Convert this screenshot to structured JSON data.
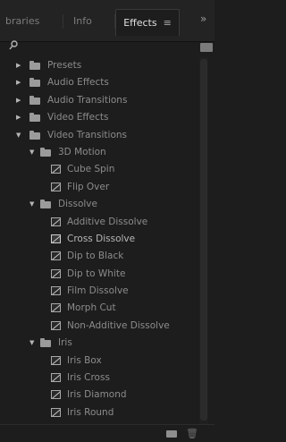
{
  "tabs": [
    {
      "label": "braries"
    },
    {
      "label": "Info"
    },
    {
      "label": "Effects",
      "menu_glyph": "≡"
    }
  ],
  "overflow_glyph": "»",
  "tree": [
    {
      "label": "Presets",
      "kind": "folder",
      "expanded": false,
      "depth": 0
    },
    {
      "label": "Audio Effects",
      "kind": "folder",
      "expanded": false,
      "depth": 0
    },
    {
      "label": "Audio Transitions",
      "kind": "folder",
      "expanded": false,
      "depth": 0
    },
    {
      "label": "Video Effects",
      "kind": "folder",
      "expanded": false,
      "depth": 0
    },
    {
      "label": "Video Transitions",
      "kind": "folder",
      "expanded": true,
      "depth": 0
    },
    {
      "label": "3D Motion",
      "kind": "folder",
      "expanded": true,
      "depth": 1
    },
    {
      "label": "Cube Spin",
      "kind": "effect",
      "depth": 2
    },
    {
      "label": "Flip Over",
      "kind": "effect",
      "depth": 2
    },
    {
      "label": "Dissolve",
      "kind": "folder",
      "expanded": true,
      "depth": 1
    },
    {
      "label": "Additive Dissolve",
      "kind": "effect",
      "depth": 2
    },
    {
      "label": "Cross Dissolve",
      "kind": "effect",
      "depth": 2,
      "selected": true
    },
    {
      "label": "Dip to Black",
      "kind": "effect",
      "depth": 2
    },
    {
      "label": "Dip to White",
      "kind": "effect",
      "depth": 2
    },
    {
      "label": "Film Dissolve",
      "kind": "effect",
      "depth": 2
    },
    {
      "label": "Morph Cut",
      "kind": "effect",
      "depth": 2
    },
    {
      "label": "Non-Additive Dissolve",
      "kind": "effect",
      "depth": 2
    },
    {
      "label": "Iris",
      "kind": "folder",
      "expanded": true,
      "depth": 1
    },
    {
      "label": "Iris Box",
      "kind": "effect",
      "depth": 2
    },
    {
      "label": "Iris Cross",
      "kind": "effect",
      "depth": 2
    },
    {
      "label": "Iris Diamond",
      "kind": "effect",
      "depth": 2
    },
    {
      "label": "Iris Round",
      "kind": "effect",
      "depth": 2
    }
  ]
}
